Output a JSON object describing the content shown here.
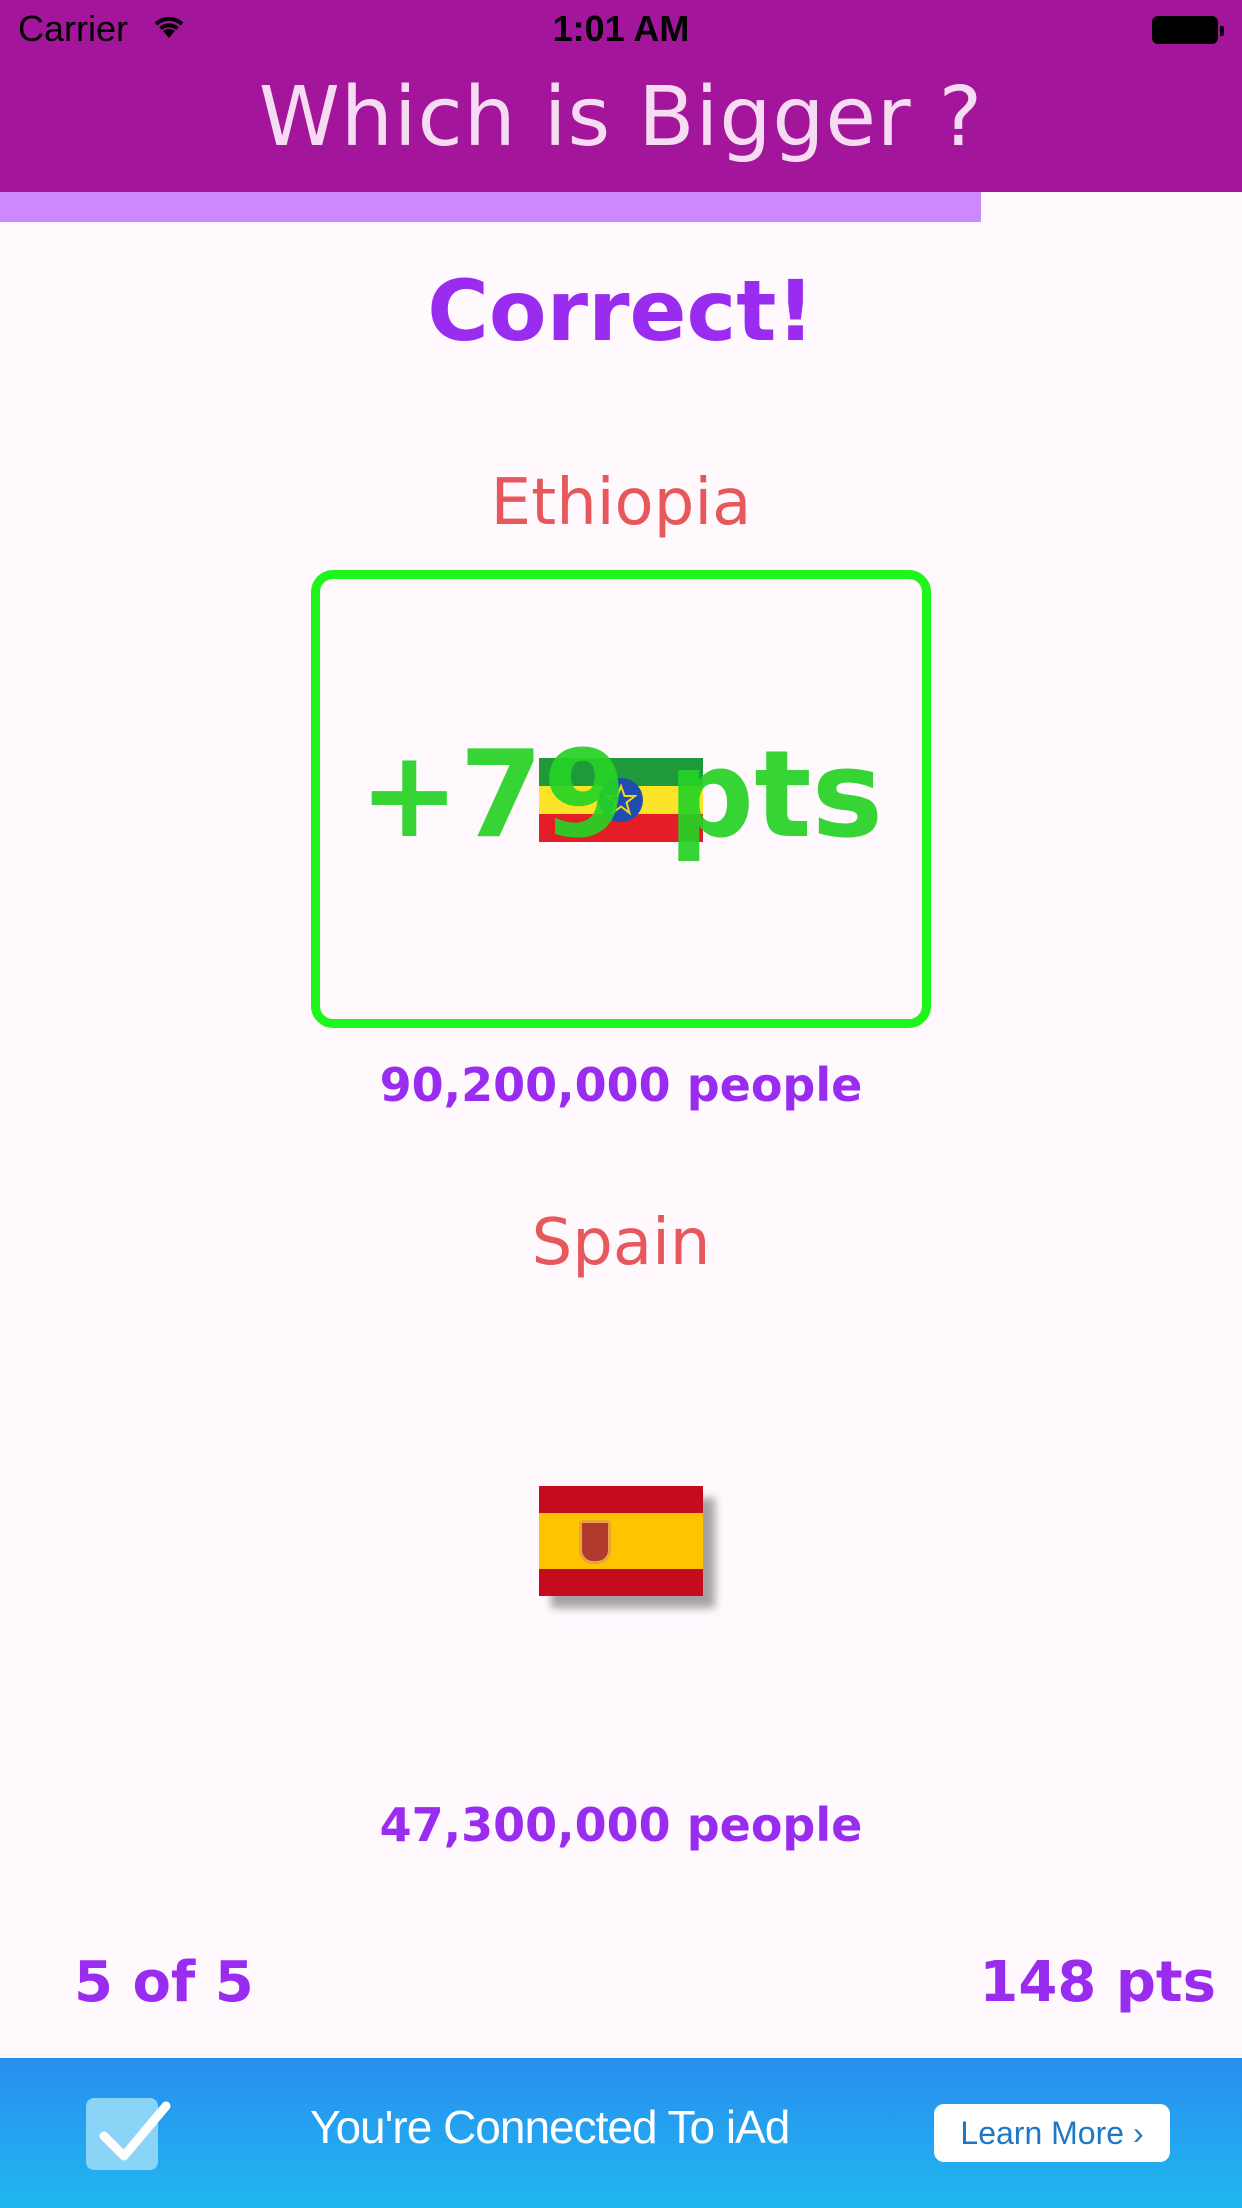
{
  "status_bar": {
    "carrier": "Carrier",
    "time": "1:01 AM"
  },
  "header": {
    "title": "Which is Bigger ?"
  },
  "progress": {
    "fraction": 0.79
  },
  "result": {
    "text": "Correct!"
  },
  "countries": [
    {
      "name": "Ethiopia",
      "population": "90,200,000 people",
      "flag": "ethiopia-flag"
    },
    {
      "name": "Spain",
      "population": "47,300,000 people",
      "flag": "spain-flag"
    }
  ],
  "popup": {
    "points": "+79 pts"
  },
  "footer": {
    "question_counter": "5 of 5",
    "score": "148 pts"
  },
  "ad": {
    "text": "You're Connected To iAd",
    "button": "Learn More ›"
  },
  "colors": {
    "header": "#a3169c",
    "accent": "#9a2cf0",
    "country_name": "#e7585c",
    "correct_border": "#1df51d",
    "progress": "#cc88ff"
  }
}
